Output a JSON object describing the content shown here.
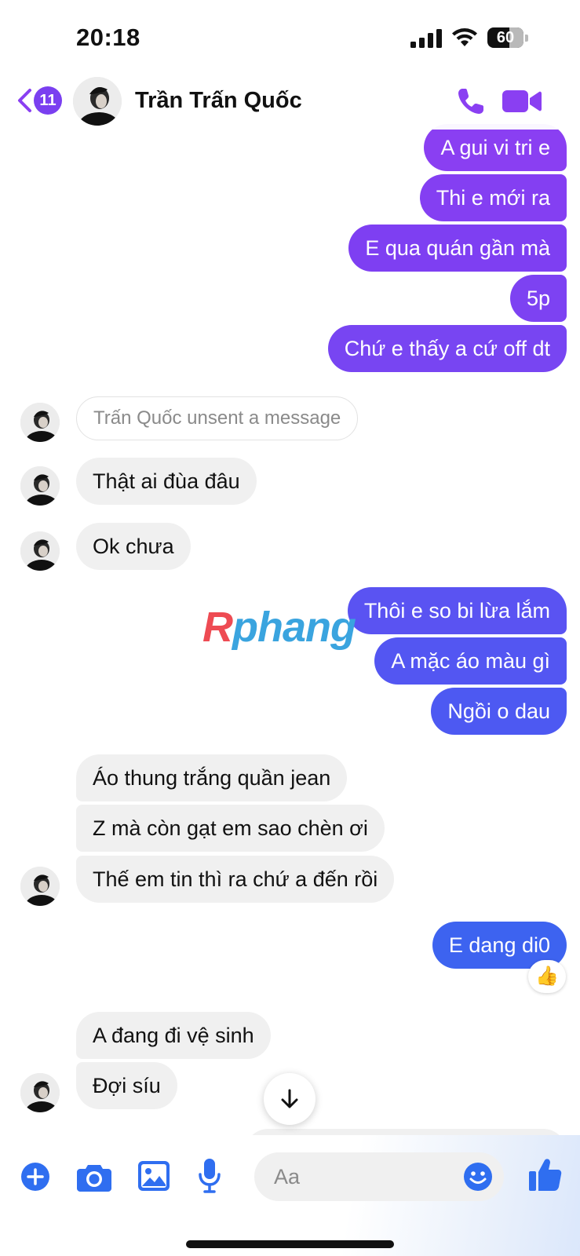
{
  "status_bar": {
    "time": "20:18",
    "battery": "60",
    "signal_icon": "cellular-signal-icon",
    "wifi_icon": "wifi-icon",
    "battery_icon": "battery-icon"
  },
  "header": {
    "back_count": "11",
    "contact_name": "Trần Trấn Quốc",
    "call_icon": "phone-icon",
    "video_icon": "video-camera-icon",
    "accent_color": "#8a3ff2"
  },
  "messages": [
    {
      "dir": "out",
      "text": "A gui vi tri e",
      "color": "#8a3ff2"
    },
    {
      "dir": "out",
      "text": "Thi e mới ra",
      "color": "#843ff2"
    },
    {
      "dir": "out",
      "text": "E qua quán gần mà",
      "color": "#7e3ff2"
    },
    {
      "dir": "out",
      "text": "5p",
      "color": "#7d42f2"
    },
    {
      "dir": "out",
      "text": "Chứ e thấy a cứ off dt",
      "color": "#7845f2"
    },
    {
      "dir": "note",
      "text": "Trấn Quốc unsent a message"
    },
    {
      "dir": "in",
      "text": "Thật ai đùa đâu"
    },
    {
      "dir": "in",
      "text": "Ok chưa"
    },
    {
      "dir": "out",
      "text": "Thôi e so bi lừa lắm",
      "color": "#5a53f2"
    },
    {
      "dir": "out",
      "text": "A mặc áo màu gì",
      "color": "#5356f2"
    },
    {
      "dir": "out",
      "text": "Ngồi o dau",
      "color": "#4d59f2"
    },
    {
      "dir": "in",
      "text": "Áo thung trắng quần jean"
    },
    {
      "dir": "in",
      "text": "Z mà còn gạt em sao chèn ơi"
    },
    {
      "dir": "in",
      "text": "Thế em tin thì ra chứ a đến rồi"
    },
    {
      "dir": "out",
      "text": "E dang di0",
      "color": "#3d63f0",
      "reaction": "👍"
    },
    {
      "dir": "in",
      "text": "A đang đi vệ sinh"
    },
    {
      "dir": "in",
      "text": "Đợi síu"
    }
  ],
  "watermark": {
    "first": "R",
    "rest": "phang"
  },
  "composer": {
    "placeholder": "Aa",
    "buttons": [
      "plus-icon",
      "camera-icon",
      "image-icon",
      "microphone-icon",
      "emoji-icon",
      "thumbs-up-icon"
    ],
    "icon_color": "#2f6ef0"
  }
}
